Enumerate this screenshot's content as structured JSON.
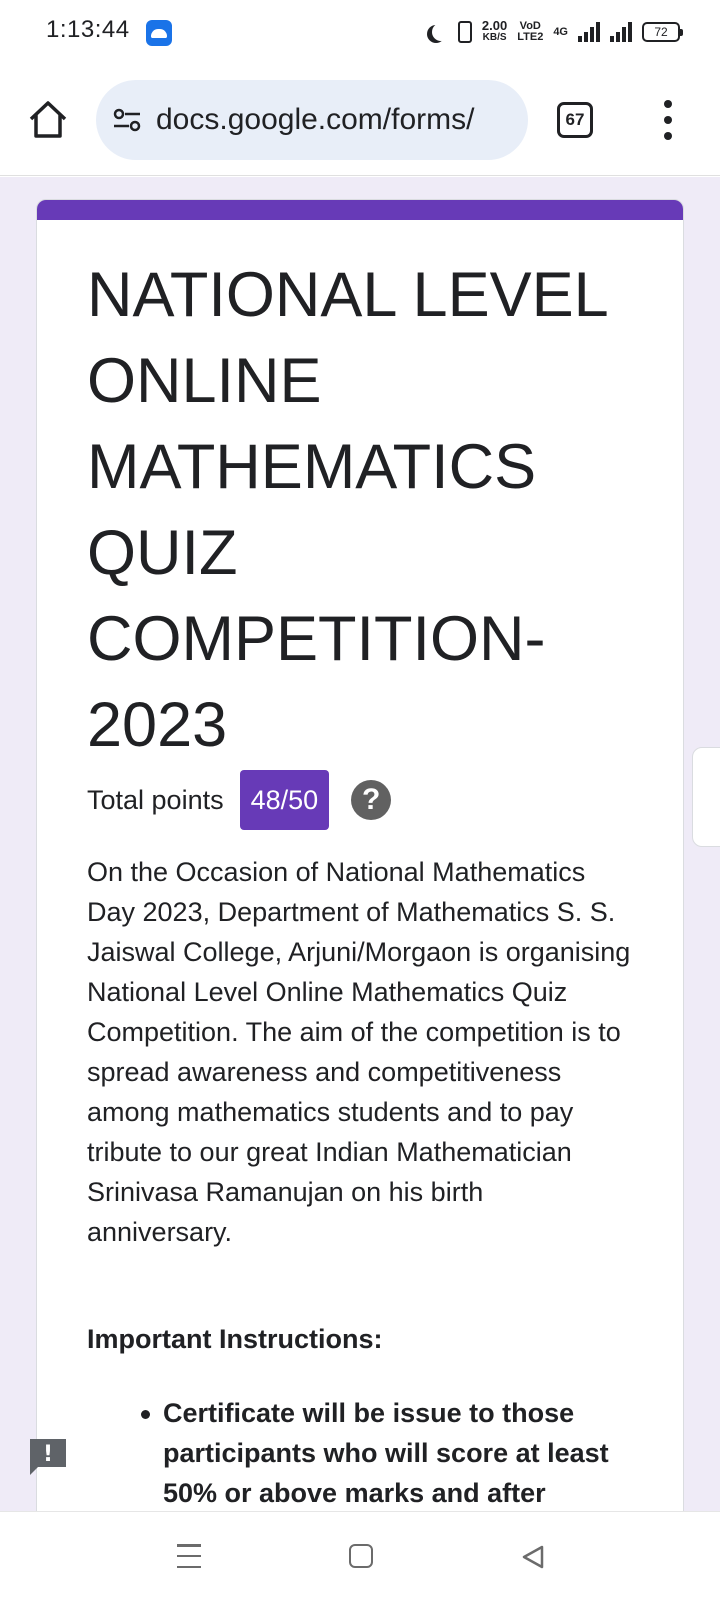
{
  "status_bar": {
    "time": "1:13:44",
    "net_speed_value": "2.00",
    "net_speed_unit": "KB/S",
    "volte_line1": "VoD",
    "volte_line2": "LTE2",
    "network_type": "4G",
    "battery_level": "72"
  },
  "browser": {
    "url": "docs.google.com/forms/",
    "tab_count": "67"
  },
  "form": {
    "accent_color": "#673ab7",
    "title": "NATIONAL LEVEL ONLINE MATHEMATICS QUIZ COMPETITION-2023",
    "points_label": "Total points",
    "points_value": "48/50",
    "help_glyph": "?",
    "description": "On the Occasion of National Mathematics Day 2023, Department of Mathematics S. S. Jaiswal College, Arjuni/Morgaon is organising National Level Online Mathematics Quiz Competition. The aim of the competition is to spread awareness and competitiveness among mathematics students and to pay tribute to our great Indian Mathematician Srinivasa Ramanujan on his birth anniversary.",
    "instructions_heading": "Important Instructions:",
    "instructions": [
      "Certificate will be issue to those participants who will score at least 50% or above marks and after"
    ]
  },
  "feedback_glyph": "!",
  "icons": {
    "home": "home-icon",
    "site_settings": "tune-icon",
    "menu": "more-vert-icon",
    "help": "help-icon",
    "feedback": "feedback-icon"
  }
}
